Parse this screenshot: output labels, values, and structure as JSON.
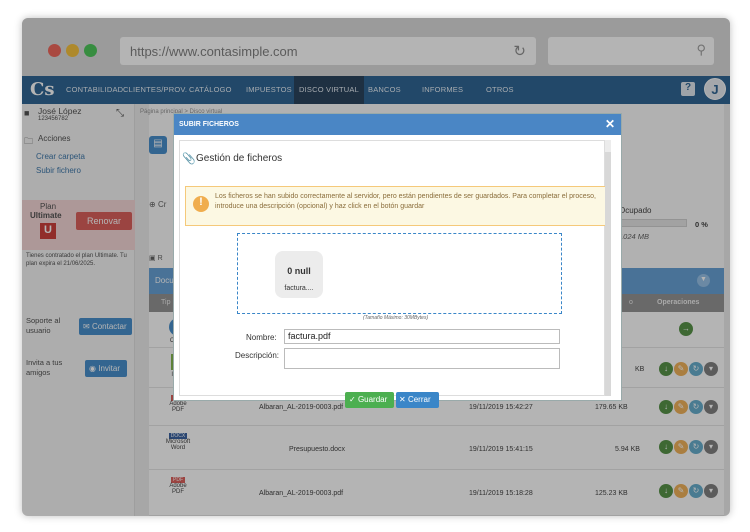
{
  "browser": {
    "url": "https://www.contasimple.com"
  },
  "nav": {
    "logo": "Cs",
    "items": [
      "CONTABILIDAD",
      "CLIENTES/PROV.",
      "CATÁLOGO",
      "IMPUESTOS",
      "DISCO VIRTUAL",
      "BANCOS",
      "INFORMES",
      "OTROS"
    ],
    "active": "DISCO VIRTUAL",
    "help_label": "?",
    "avatar_initial": "J",
    "brand_color": "#1f5a8c"
  },
  "sidebar": {
    "user_name": "José López",
    "user_id": "123456782",
    "section_title": "Acciones",
    "links": [
      "Crear carpeta",
      "Subir fichero"
    ],
    "plan_label": "Plan",
    "plan_name": "Ultimate",
    "plan_letter": "U",
    "renew_label": "Renovar",
    "plan_info": "Tienes contratado el plan Ultimate. Tu plan expira el 21/06/2025.",
    "support_label": "Soporte al usuario",
    "contact_label": "Contactar",
    "invite_label": "Invita a tus amigos",
    "invite_button": "Invitar"
  },
  "main": {
    "breadcrumb": "Página principal > Disco virtual",
    "new_folder_fragment": "Cr",
    "occupied_label": "Ocupado",
    "occupied_percent": "0 %",
    "quota": "1024 MB",
    "refresh_fragment": "R",
    "table_title_fragment": "Docu",
    "col_type_fragment": "Tip",
    "col_size_fragment": "o",
    "col_ops": "Operaciones",
    "rows": [
      {
        "icon": "folder",
        "type": "Carpe",
        "name": "",
        "date": "",
        "size": ""
      },
      {
        "icon": "image",
        "type": "Imag",
        "name": "",
        "date": "",
        "size": "KB"
      },
      {
        "icon": "pdf",
        "type": "Adobe PDF",
        "name": "Albaran_AL-2019-0003.pdf",
        "date": "19/11/2019 15:42:27",
        "size": "179.65 KB"
      },
      {
        "icon": "docx",
        "type": "Microsoft Word",
        "name": "Presupuesto.docx",
        "date": "19/11/2019 15:41:15",
        "size": "5.94 KB"
      },
      {
        "icon": "pdf",
        "type": "Adobe PDF",
        "name": "Albaran_AL-2019-0003.pdf",
        "date": "19/11/2019 15:18:28",
        "size": "125.23 KB"
      }
    ]
  },
  "modal": {
    "header": "SUBIR FICHEROS",
    "close": "✕",
    "title": "Gestión de ficheros",
    "warning": "Los ficheros se han subido correctamente al servidor, pero están pendientes de ser guardados. Para completar el proceso, introduce una descripción (opcional) y haz click en el botón guardar",
    "thumb_size": "0 null",
    "thumb_name": "factura....",
    "max_size_note": "(Tamaño Máximo: 30MBytes)",
    "name_label": "Nombre:",
    "name_value": "factura.pdf",
    "desc_label": "Descripción:",
    "desc_value": "",
    "save_label": "Guardar",
    "cancel_label": "Cerrar"
  }
}
